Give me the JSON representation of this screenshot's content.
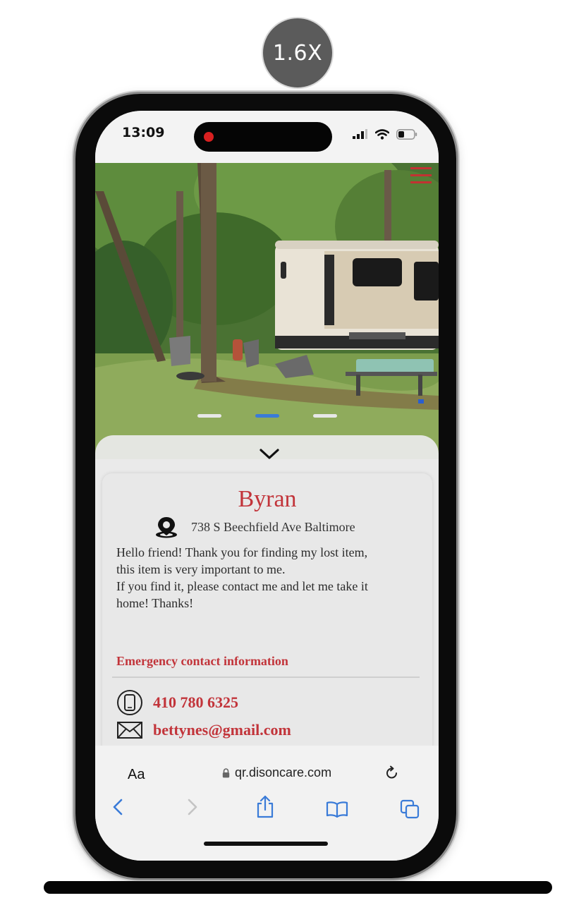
{
  "playback": {
    "speed_label": "1.6X"
  },
  "status_bar": {
    "time": "13:09"
  },
  "profile": {
    "name": "Byran",
    "address": "738 S Beechfield Ave Baltimore",
    "message_lines": [
      "Hello friend! Thank you for finding my lost item,",
      "this item is very important to me.",
      "If you find it, please contact me and let me take it",
      "home! Thanks!"
    ]
  },
  "emergency": {
    "title": "Emergency contact information",
    "phone": "410 780 6325",
    "email": "bettynes@gmail.com"
  },
  "browser": {
    "text_size_label": "Aa",
    "url": "qr.disoncare.com"
  },
  "carousel": {
    "count": 3,
    "active_index": 1
  },
  "colors": {
    "accent_red": "#c2343a",
    "link_blue": "#3a7bd8"
  },
  "icons": [
    "location-pin-icon",
    "phone-icon",
    "mail-icon",
    "lock-icon",
    "reload-icon",
    "back-icon",
    "forward-icon",
    "share-icon",
    "bookmarks-icon",
    "tabs-icon",
    "chevron-down-icon",
    "menu-icon",
    "signal-icon",
    "wifi-icon",
    "battery-icon"
  ]
}
